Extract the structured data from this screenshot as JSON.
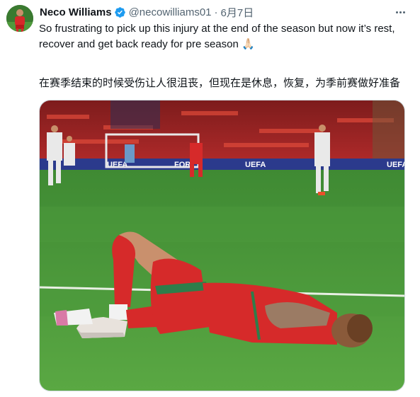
{
  "tweet": {
    "author_name": "Neco Williams",
    "handle": "@necowilliams01",
    "separator": "·",
    "date": "6月7日",
    "text": "So frustrating to pick up this injury at the end of the season but now it’s rest, recover and get back ready for pre season",
    "emoji": "🙏🏻",
    "translation": "在赛季结束的时候受伤让人很沮丧，但现在是休息，恢复，为季前赛做好准备",
    "verified_icon": "verified-badge-icon",
    "more_icon": "more-options-icon"
  },
  "media": {
    "ad_boards": [
      "UEFA",
      "FOR",
      "UEFA",
      "UEFA"
    ]
  },
  "colors": {
    "verified": "#1d9bf0",
    "text": "#0f1419",
    "secondary": "#536471",
    "border": "#cfd9de",
    "pitch": "#4d9a3a",
    "kit_red": "#d62a2a"
  }
}
